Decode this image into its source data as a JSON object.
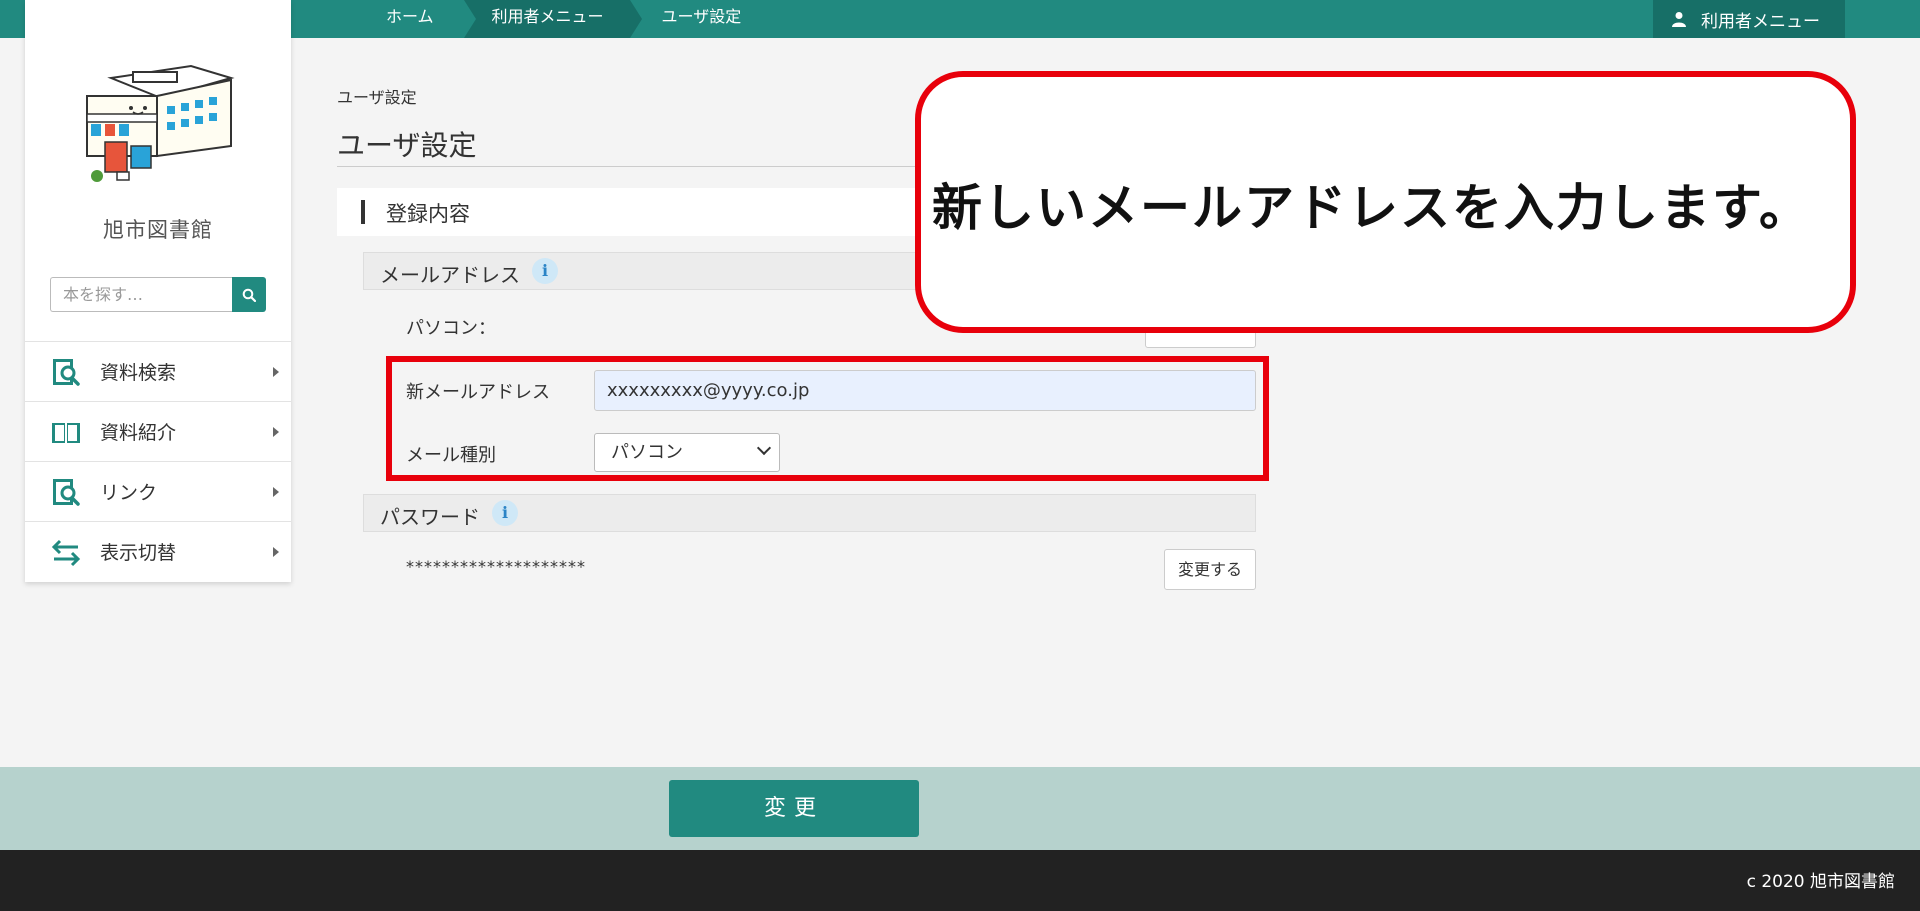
{
  "header": {
    "breadcrumbs": [
      "ホーム",
      "利用者メニュー",
      "ユーザ設定"
    ],
    "user_menu_label": "利用者メニュー",
    "user_icon": "user-icon"
  },
  "sidebar": {
    "library_name": "旭市図書館",
    "search": {
      "placeholder": "本を探す…",
      "icon": "search-icon"
    },
    "items": [
      {
        "label": "資料検索",
        "icon": "book-search-icon"
      },
      {
        "label": "資料紹介",
        "icon": "open-book-icon"
      },
      {
        "label": "リンク",
        "icon": "link-search-icon"
      },
      {
        "label": "表示切替",
        "icon": "swap-arrows-icon"
      }
    ]
  },
  "main": {
    "breadcrumb": "ユーザ設定",
    "title": "ユーザ設定",
    "section_title": "登録内容",
    "email_section": {
      "title": "メールアドレス",
      "pc_label": "パソコン：",
      "new_email_label": "新メールアドレス",
      "new_email_value": "xxxxxxxxx@yyyy.co.jp",
      "mail_type_label": "メール種別",
      "mail_type_value": "パソコン"
    },
    "password_section": {
      "title": "パスワード",
      "masked": "********************",
      "change_button": "変更する"
    },
    "submit_button": "変更"
  },
  "callout": {
    "text": "新しいメールアドレスを入力します。",
    "border_color": "#e8000b"
  },
  "footer": {
    "copyright": "c 2020 旭市図書館"
  },
  "colors": {
    "accent": "#218a80",
    "accent_dark": "#176f67",
    "highlight": "#e8000b"
  }
}
